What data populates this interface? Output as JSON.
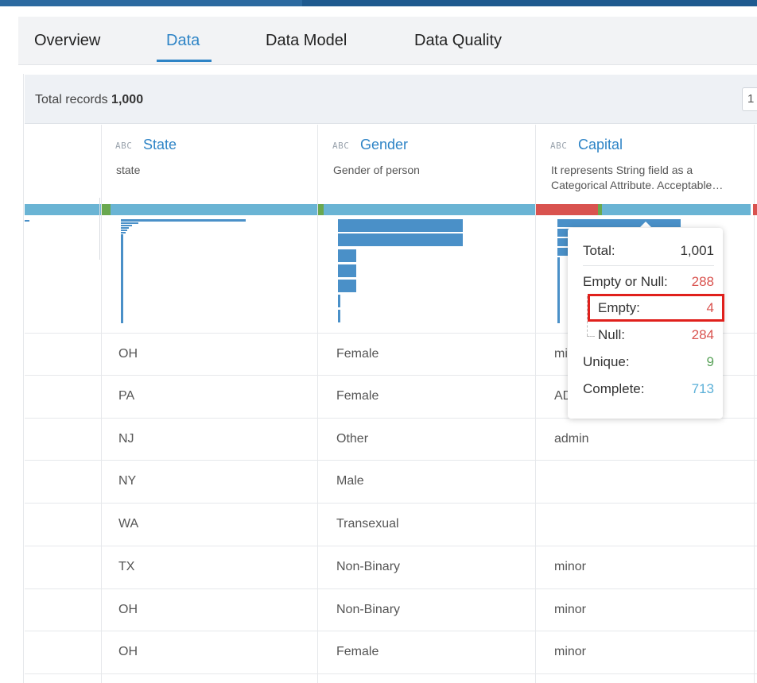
{
  "tabs": [
    {
      "label": "Overview",
      "active": false
    },
    {
      "label": "Data",
      "active": true
    },
    {
      "label": "Data Model",
      "active": false
    },
    {
      "label": "Data Quality",
      "active": false
    }
  ],
  "records": {
    "label": "Total records",
    "count": "1,000",
    "page_input": "1"
  },
  "columns": [
    {
      "type": "ABC",
      "name": "State",
      "description_lines": [
        "state"
      ]
    },
    {
      "type": "ABC",
      "name": "Gender",
      "description_lines": [
        "Gender of person"
      ]
    },
    {
      "type": "ABC",
      "name": "Capital",
      "description_lines": [
        "It represents String field as a",
        "Categorical Attribute. Acceptable…"
      ]
    }
  ],
  "rows": [
    [
      "OH",
      "Female",
      "mi"
    ],
    [
      "PA",
      "Female",
      "AD"
    ],
    [
      "NJ",
      "Other",
      "admin"
    ],
    [
      "NY",
      "Male",
      ""
    ],
    [
      "WA",
      "Transexual",
      ""
    ],
    [
      "TX",
      "Non-Binary",
      "minor"
    ],
    [
      "OH",
      "Non-Binary",
      "minor"
    ],
    [
      "OH",
      "Female",
      "minor"
    ]
  ],
  "tooltip": {
    "total_label": "Total:",
    "total_value": "1,001",
    "empty_or_null_label": "Empty or Null:",
    "empty_or_null_value": "288",
    "empty_label": "Empty:",
    "empty_value": "4",
    "null_label": "Null:",
    "null_value": "284",
    "unique_label": "Unique:",
    "unique_value": "9",
    "complete_label": "Complete:",
    "complete_value": "713"
  },
  "colors": {
    "accent": "#2e84c6",
    "quality_valid": "#6ab4d4",
    "quality_unique": "#6aa84f",
    "quality_empty": "#d9534f",
    "histogram": "#4a90c8",
    "highlight": "#e0201c"
  }
}
